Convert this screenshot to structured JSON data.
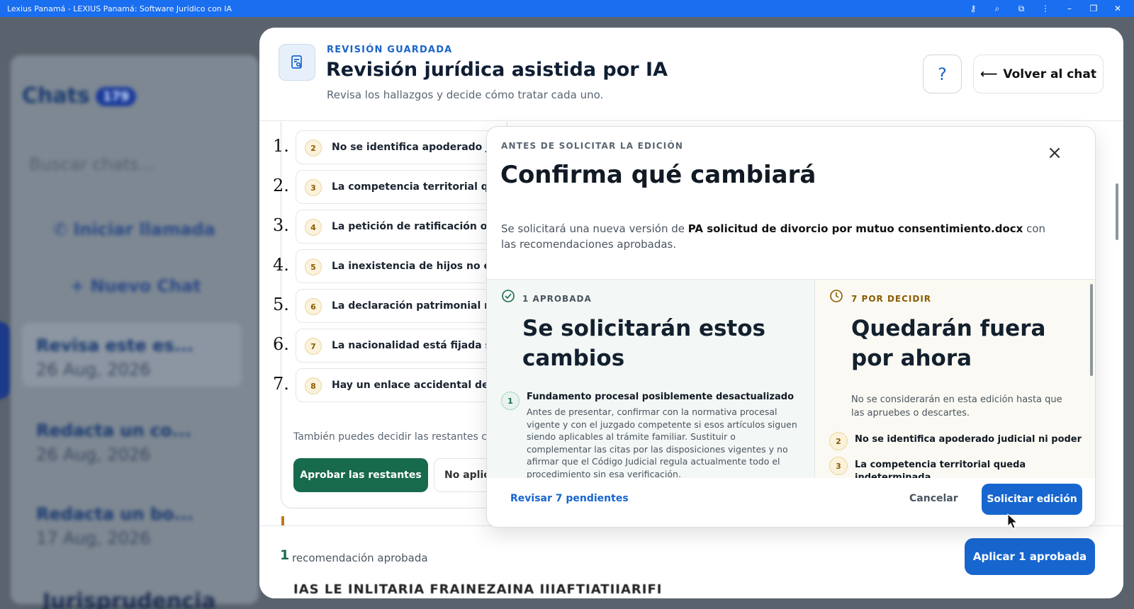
{
  "titlebar": {
    "title": "Lexius Panamá - LEXIUS Panamá: Software Jurídico con IA",
    "controls": [
      "key-icon",
      "zoom-icon",
      "extension-icon",
      "more-icon",
      "minimize-icon",
      "maximize-icon",
      "close-icon"
    ]
  },
  "background_app": {
    "chats_heading": "Chats",
    "chats_count": "179",
    "search_placeholder": "Buscar chats...",
    "start_call": "Iniciar llamada",
    "new_chat": "Nuevo Chat",
    "chat_items": [
      {
        "title": "Revisa este es...",
        "date": "26 Aug, 2026"
      },
      {
        "title": "Redacta un co...",
        "date": "26 Aug, 2026"
      },
      {
        "title": "Redacta un bo...",
        "date": "17 Aug, 2026"
      }
    ],
    "bottom_text": "Jurisprudencia"
  },
  "review": {
    "kicker": "REVISIÓN GUARDADA",
    "title": "Revisión jurídica asistida por IA",
    "subtitle": "Revisa los hallazgos y decide cómo tratar cada uno.",
    "help_label": "?",
    "back_label": "Volver al chat",
    "findings": [
      {
        "list_no": "1.",
        "badge": "2",
        "text": "No se identifica apoderado ju"
      },
      {
        "list_no": "2.",
        "badge": "3",
        "text": "La competencia territorial qu"
      },
      {
        "list_no": "3.",
        "badge": "4",
        "text": "La petición de ratificación om"
      },
      {
        "list_no": "4.",
        "badge": "5",
        "text": "La inexistencia de hijos no est"
      },
      {
        "list_no": "5.",
        "badge": "6",
        "text": "La declaración patrimonial re"
      },
      {
        "list_no": "6.",
        "badge": "7",
        "text": "La nacionalidad está fijada si"
      },
      {
        "list_no": "7.",
        "badge": "8",
        "text": "Hay un enlace accidental der"
      }
    ],
    "also_text": "También puedes decidir las restantes c",
    "approve_rest_label": "Aprobar las restantes",
    "no_apply_label": "No aplic",
    "footer_count": "1",
    "footer_text": "recomendación aprobada",
    "apply_label": "Aplicar 1 aprobada",
    "cut_text": "IAS LE INLITARIA FRAINEZAINA IIIAFTIATIIARIFI"
  },
  "confirm": {
    "kicker": "ANTES DE SOLICITAR LA EDICIÓN",
    "title": "Confirma qué cambiará",
    "close_label": "×",
    "desc_pre": "Se solicitará una nueva versión de ",
    "desc_file": "PA solicitud de divorcio por mutuo consentimiento.docx",
    "desc_post": " con las recomendaciones aprobadas.",
    "approved": {
      "badge": "1 APROBADA",
      "heading": "Se solicitarán estos cambios",
      "item_no": "1",
      "item_title": "Fundamento procesal posiblemente desactualizado",
      "item_body": "Antes de presentar, confirmar con la normativa procesal vigente y con el juzgado competente si esos artículos siguen siendo aplicables al trámite familiar. Sustituir o complementar las citas por las disposiciones vigentes y no afirmar que el Código Judicial regula actualmente todo el procedimiento sin esa verificación."
    },
    "pending": {
      "badge": "7 POR DECIDIR",
      "heading": "Quedarán fuera por ahora",
      "note": "No se considerarán en esta edición hasta que las apruebes o descartes.",
      "items": [
        {
          "no": "2",
          "title": "No se identifica apoderado judicial ni poder"
        },
        {
          "no": "3",
          "title": "La competencia territorial queda indeterminada"
        }
      ]
    },
    "review_pending_label": "Revisar 7 pendientes",
    "cancel_label": "Cancelar",
    "request_label": "Solicitar edición"
  },
  "colors": {
    "titlebar": "#1a6ef0",
    "accent_blue": "#1766cf",
    "accent_green": "#186a4c",
    "pending_amber": "#8a5c00"
  }
}
